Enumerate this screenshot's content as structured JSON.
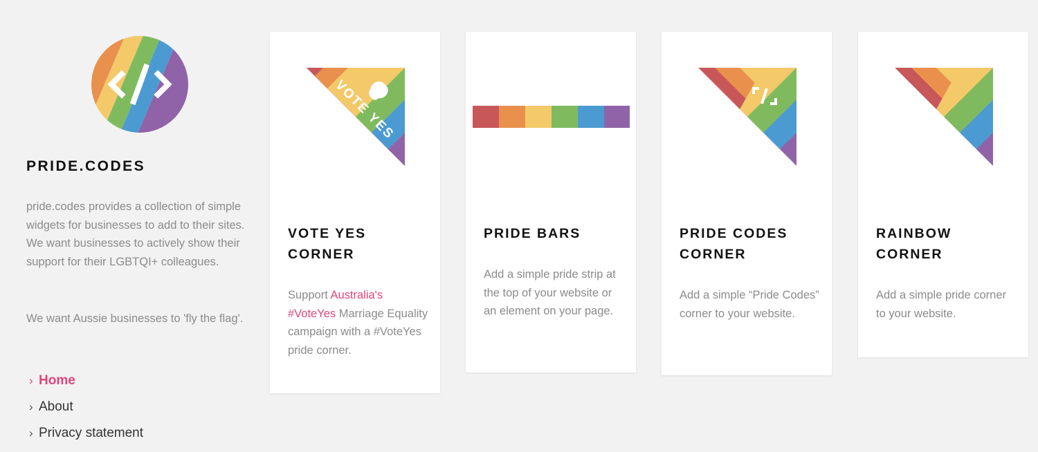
{
  "site": {
    "title": "PRIDE.CODES",
    "description1": "pride.codes provides a collection of simple widgets for businesses to add to their sites. We want businesses to actively show their support for their LGBTQI+ colleagues.",
    "description2": "We want Aussie businesses to 'fly the flag'.",
    "logo_icon": "code-brackets-icon"
  },
  "nav": [
    {
      "label": "Home",
      "active": true
    },
    {
      "label": "About",
      "active": false
    },
    {
      "label": "Privacy statement",
      "active": false
    }
  ],
  "cards": [
    {
      "title_line1": "VOTE YES",
      "title_line2": "CORNER",
      "desc_pre": "Support ",
      "link1": "Australia's",
      "link2": "#VoteYes",
      "desc_post": " Marriage Equality campaign with a #VoteYes pride corner.",
      "graphic_text": "VOTE YES"
    },
    {
      "title_line1": "PRIDE BARS",
      "desc": "Add a simple pride strip at the top of your website or an element on your page."
    },
    {
      "title_line1": "PRIDE CODES",
      "title_line2": "CORNER",
      "desc": "Add a simple “Pride Codes” corner to your website."
    },
    {
      "title_line1": "RAINBOW",
      "title_line2": "CORNER",
      "desc": "Add a simple pride corner to your website."
    }
  ],
  "colors": {
    "accent": "#e0457b",
    "rainbow": [
      "#c8575a",
      "#e9914c",
      "#f3c969",
      "#7fbb5e",
      "#4b9bd2",
      "#9063a8"
    ]
  }
}
